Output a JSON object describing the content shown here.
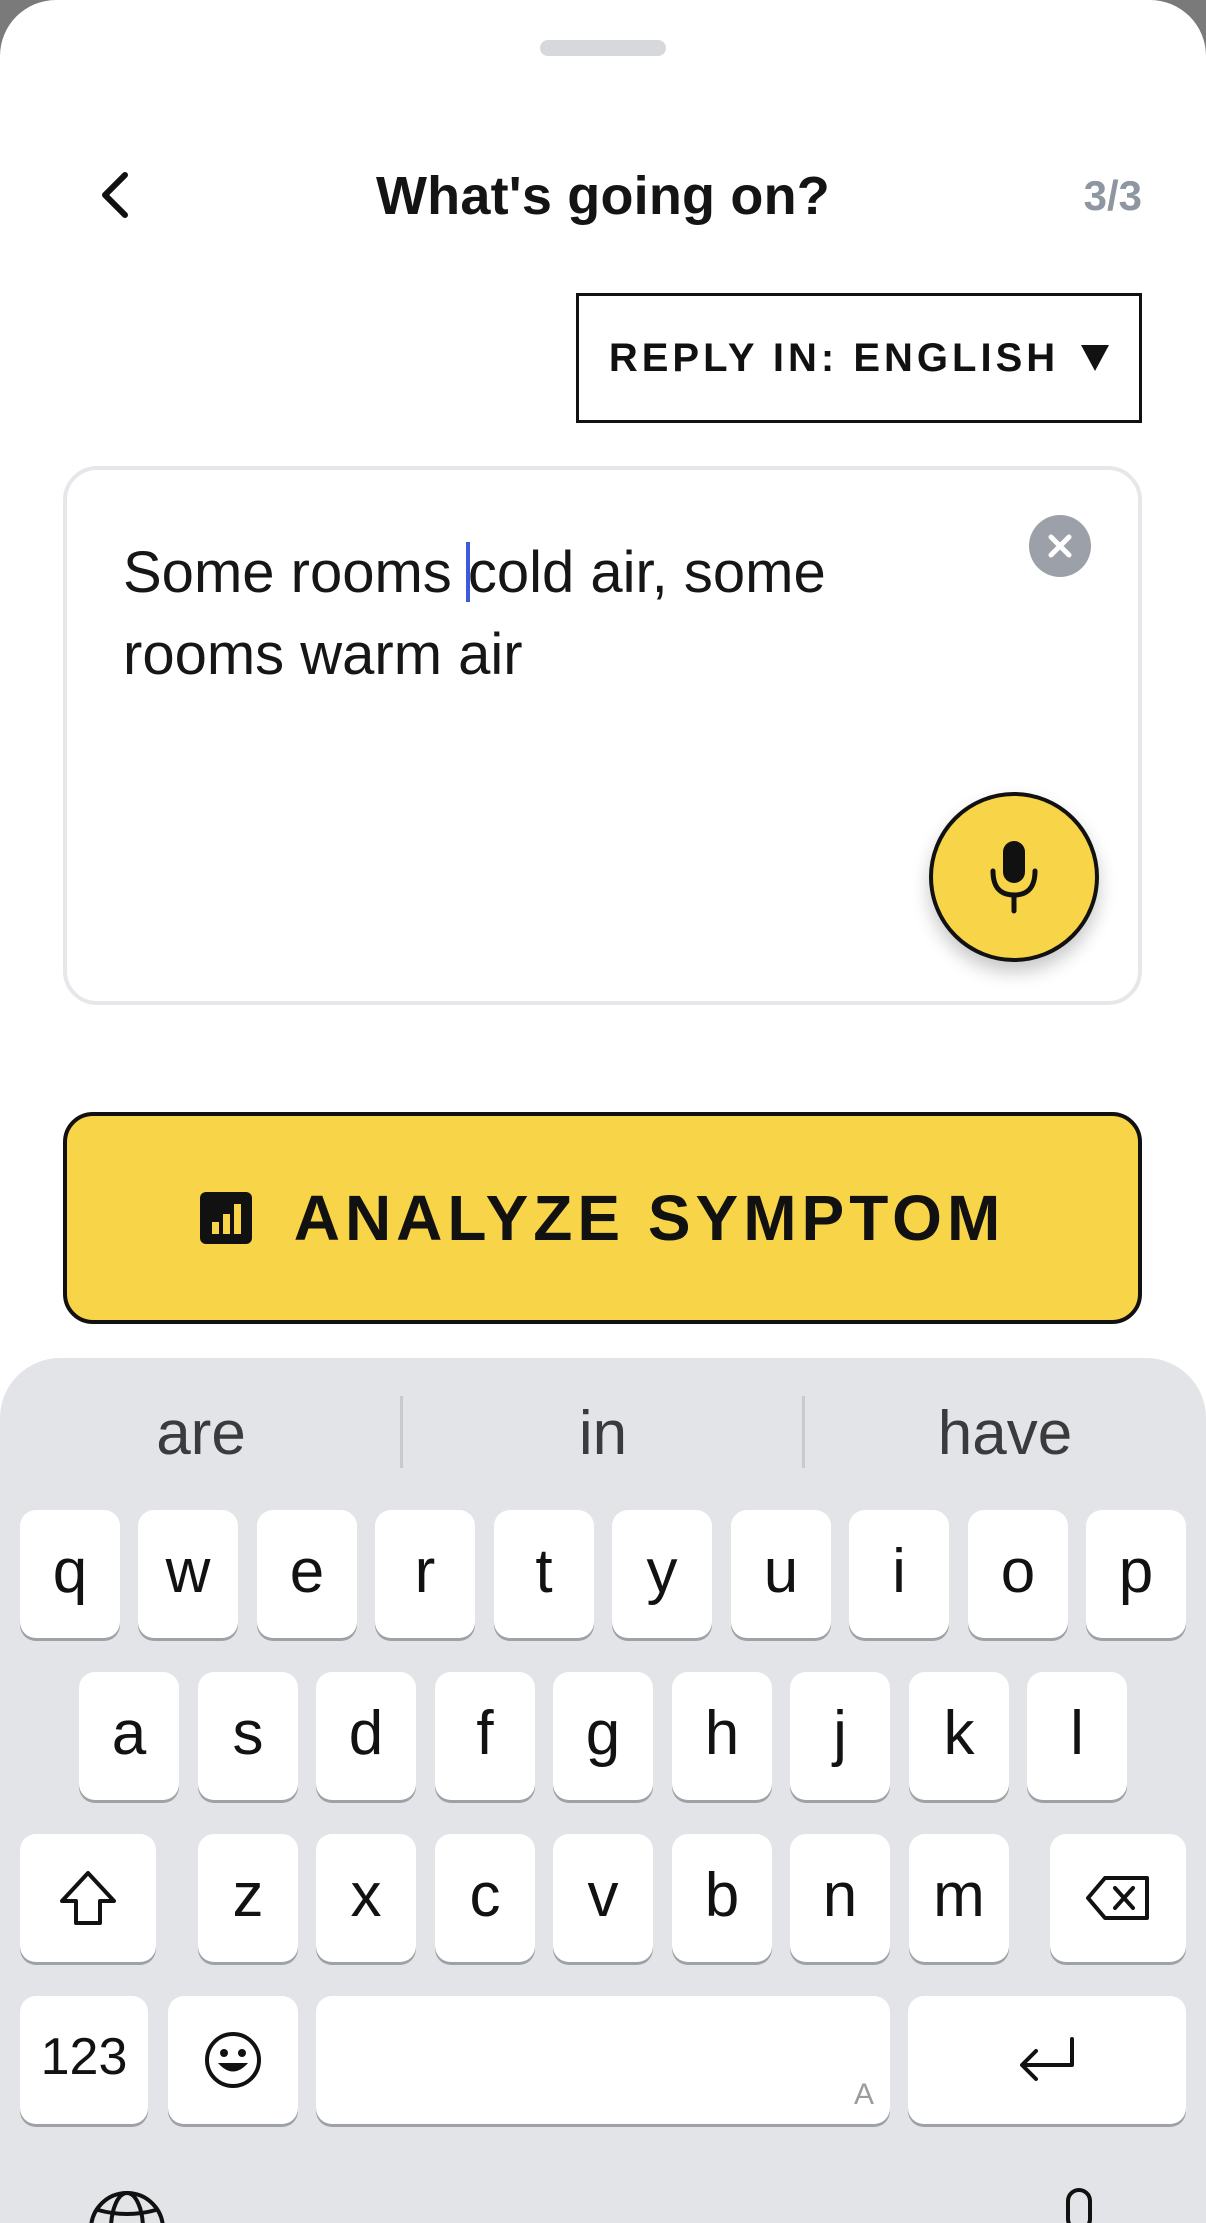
{
  "header": {
    "title": "What's going on?",
    "step": "3/3"
  },
  "reply_language": {
    "label": "REPLY IN: ENGLISH"
  },
  "symptom_input": {
    "value_before_cursor": "Some rooms ",
    "value_after_cursor": "cold air, some rooms warm air"
  },
  "analyze_button": {
    "label": "ANALYZE SYMPTOM"
  },
  "colors": {
    "accent_yellow": "#f7d448",
    "text_dark": "#111111",
    "cursor_blue": "#3d5bd9",
    "keyboard_bg": "#e3e4e7"
  },
  "keyboard": {
    "suggestions": [
      "are",
      "in",
      "have"
    ],
    "row1": [
      "q",
      "w",
      "e",
      "r",
      "t",
      "y",
      "u",
      "i",
      "o",
      "p"
    ],
    "row2": [
      "a",
      "s",
      "d",
      "f",
      "g",
      "h",
      "j",
      "k",
      "l"
    ],
    "row3": [
      "z",
      "x",
      "c",
      "v",
      "b",
      "n",
      "m"
    ],
    "numbers_label": "123",
    "space_hint": "A",
    "icons": [
      "shift-icon",
      "backspace-icon",
      "emoji-icon",
      "return-icon"
    ]
  }
}
